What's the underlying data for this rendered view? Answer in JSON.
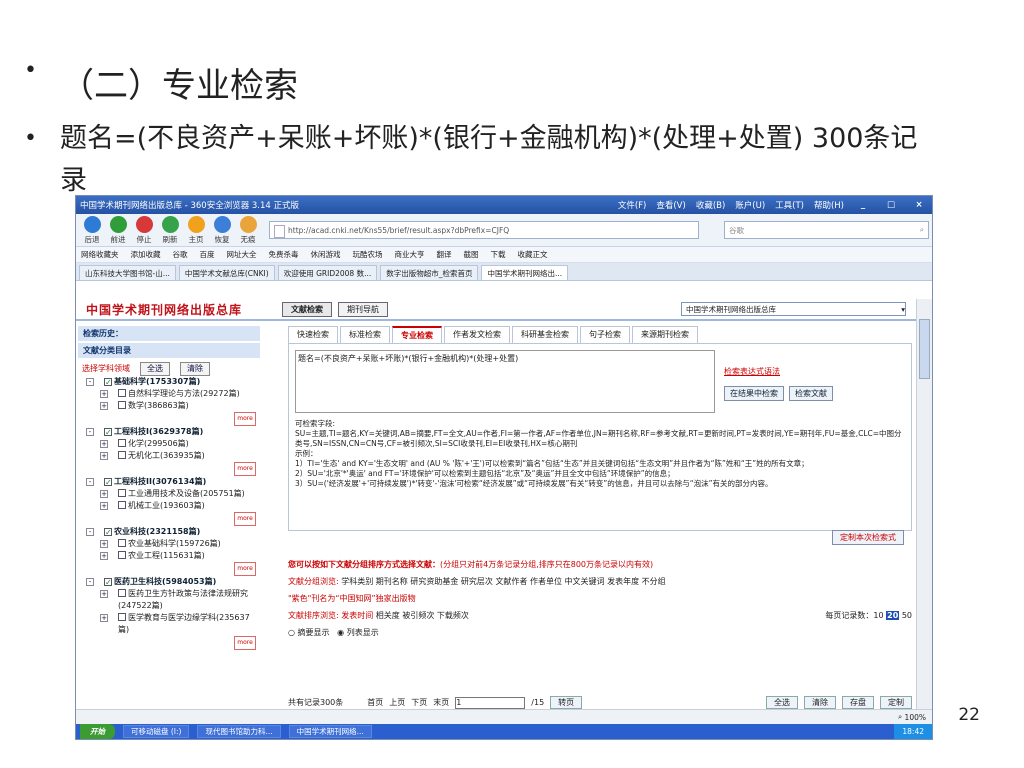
{
  "slide": {
    "bullet1": "（二）专业检索",
    "bullet2": "题名=(不良资产+呆账+坏账)*(银行+金融机构)*(处理+处置)   300条记录",
    "page_number": "22"
  },
  "browser": {
    "title": "中国学术期刊网络出版总库 - 360安全浏览器 3.14 正式版",
    "menu": [
      "文件(F)",
      "查看(V)",
      "收藏(B)",
      "账户(U)",
      "工具(T)",
      "帮助(H)"
    ],
    "toolbar": [
      "后退",
      "前进",
      "停止",
      "刷新",
      "主页",
      "恢复",
      "无痕"
    ],
    "address": "http://acad.cnki.net/Kns55/brief/result.aspx?dbPrefix=CJFQ",
    "search_placeholder": "谷歌",
    "favorites": [
      "网络收藏夹",
      "添加收藏",
      "谷歌",
      "百度",
      "网址大全",
      "免费杀毒",
      "休闲游戏",
      "玩酷农场",
      "商业大亨",
      "翻译",
      "截图",
      "下载",
      "收藏正文"
    ],
    "tabs": [
      "山东科技大学图书馆-山...",
      "中国学术文献总库(CNKI)",
      "欢迎使用 GRID2008 数...",
      "数字出版物超市_检索首页",
      "中国学术期刊网络出..."
    ]
  },
  "cnki": {
    "logo": "中国学术期刊网络出版总库",
    "nav": [
      "文献检索",
      "期刊导航"
    ],
    "db": "中国学术期刊网络出版总库",
    "history": "检索历史：",
    "category": "文献分类目录",
    "select_label": "选择学科领域",
    "select_all": "全选",
    "clear": "清除",
    "tree": [
      "基础科学(1753307篇)",
      "自然科学理论与方法(29272篇)",
      "数学(386863篇)",
      "工程科技I(3629378篇)",
      "化学(299506篇)",
      "无机化工(363935篇)",
      "工程科技II(3076134篇)",
      "工业通用技术及设备(205751篇)",
      "机械工业(193603篇)",
      "农业科技(2321158篇)",
      "农业基础科学(159726篇)",
      "农业工程(115631篇)",
      "医药卫生科技(5984053篇)",
      "医药卫生方针政策与法律法规研究(247522篇)",
      "医学教育与医学边缘学科(235637篇)"
    ],
    "search_tabs": [
      "快速检索",
      "标准检索",
      "专业检索",
      "作者发文检索",
      "科研基金检索",
      "句子检索",
      "来源期刊检索"
    ],
    "query": "题名=(不良资产+呆账+坏账)*(银行+金融机构)*(处理+处置)",
    "syntax_link": "检索表达式语法",
    "btn_in_result": "在结果中检索",
    "btn_search": "检索文献",
    "help_title": "可检索字段:",
    "help_fields": "SU=主题,TI=题名,KY=关键词,AB=摘要,FT=全文,AU=作者,FI=第一作者,AF=作者单位,JN=期刊名称,RF=参考文献,RT=更新时间,PT=发表时间,YE=期刊年,FU=基金,CLC=中图分类号,SN=ISSN,CN=CN号,CF=被引频次,SI=SCI收录刊,EI=EI收录刊,HX=核心期刊",
    "example_title": "示例：",
    "example1": "1）TI='生态' and KY='生态文明' and (AU % '陈'+'王')可以检索到“篇名”包括“生态”并且关键词包括“生态文明”并且作者为“陈”姓和“王”姓的所有文章；",
    "example2": "2）SU='北京'*'奥运' and FT='环境保护'可以检索到主题包括“北京”及“奥运”并且全文中包括“环境保护”的信息；",
    "example3": "3）SU=('经济发展'+'可持续发展')*'转变'-'泡沫'可检索“经济发展”或“可持续发展”有关“转变”的信息，并且可以去除与“泡沫”有关的部分内容。",
    "save_btn": "定制本次检索式",
    "group_note": "您可以按如下文献分组排序方式选择文献：",
    "group_note2": "(分组只对前4万条记录分组,排序只在800万条记录以内有效)",
    "group_label": "文献分组浏览:",
    "groups": [
      "学科类别",
      "期刊名称",
      "研究资助基金",
      "研究层次",
      "文献作者",
      "作者单位",
      "中文关键词",
      "发表年度",
      "不分组"
    ],
    "ziji": "\"紫色\"刊名为“中国知网”独家出版物",
    "sort_label": "文献排序浏览:",
    "sorts": [
      "发表时间",
      "相关度",
      "被引频次",
      "下载频次"
    ],
    "per_page_label": "每页记录数：",
    "per_page": [
      "10",
      "20",
      "50"
    ],
    "display": [
      "摘要显示",
      "列表显示"
    ],
    "total": "共有记录300条",
    "pager": [
      "首页",
      "上页",
      "下页",
      "末页"
    ],
    "page_input": "1",
    "page_total": "/15",
    "goto": "转页",
    "actions": [
      "全选",
      "清除",
      "存盘",
      "定制"
    ]
  },
  "statusbar": {
    "zoom": "100%"
  },
  "taskbar": {
    "start": "开始",
    "items": [
      "可移动磁盘 (I:)",
      "现代图书馆助力科...",
      "中国学术期刊网络..."
    ],
    "clock": "18:42"
  }
}
